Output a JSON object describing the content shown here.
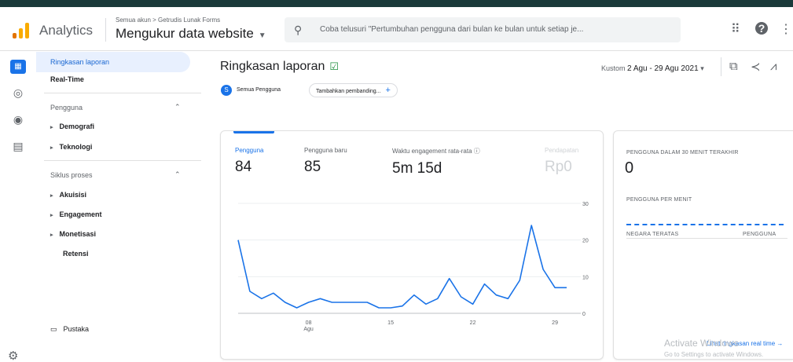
{
  "header": {
    "app_name": "Analytics",
    "breadcrumb": "Semua akun > Getrudis Lunak Forms",
    "property": "Mengukur data website",
    "search_placeholder": "Coba telusuri \"Pertumbuhan pengguna dari bulan ke bulan untuk setiap je...",
    "icons": [
      "apps-icon",
      "help-icon",
      "more-vert-icon"
    ]
  },
  "rail": {
    "icons": [
      "reports-icon",
      "explore-icon",
      "advertising-icon",
      "configure-icon"
    ]
  },
  "nav": {
    "summary": "Ringkasan laporan",
    "realtime": "Real-Time",
    "sec_user": "Pengguna",
    "user_items": [
      "Demografi",
      "Teknologi"
    ],
    "sec_lifecycle": "Siklus proses",
    "lifecycle_items": [
      "Akuisisi",
      "Engagement",
      "Monetisasi"
    ],
    "retention": "Retensi",
    "library": "Pustaka"
  },
  "main": {
    "title": "Ringkasan laporan",
    "date_prefix": "Kustom",
    "date_range": "2 Agu - 29 Agu 2021",
    "chip_letter": "S",
    "chip_all_users": "Semua Pengguna",
    "chip_compare": "Tambahkan pembanding...",
    "metrics": [
      {
        "label": "Pengguna",
        "value": "84"
      },
      {
        "label": "Pengguna baru",
        "value": "85"
      },
      {
        "label": "Waktu engagement rata-rata",
        "value": "5m 15d"
      },
      {
        "label": "Pendapatan",
        "value": "Rp0"
      }
    ]
  },
  "realtime": {
    "title": "PENGGUNA DALAM 30 MENIT TERAKHIR",
    "value": "0",
    "per_minute": "PENGGUNA PER MENIT",
    "col_country": "NEGARA TERATAS",
    "col_users": "PENGGUNA",
    "link": "Lihat ringkasan real time →"
  },
  "watermark": {
    "line1": "Activate Windows",
    "line2": "Go to Settings to activate Windows."
  },
  "colors": {
    "accent": "#1a73e8",
    "logo_orange": "#f9ab00",
    "logo_dark": "#e37400"
  },
  "chart_data": {
    "type": "line",
    "x_tick_labels": [
      "08\nAgu",
      "15",
      "22",
      "29"
    ],
    "x_tick_index": [
      6,
      13,
      20,
      27
    ],
    "y_ticks": [
      0,
      10,
      20,
      30
    ],
    "ylim": [
      0,
      30
    ],
    "series": [
      {
        "values": [
          20,
          6,
          4,
          5.5,
          3,
          1.5,
          3,
          4,
          3,
          3,
          3,
          3,
          1.5,
          1.5,
          2,
          5,
          2.5,
          4,
          9.5,
          4.5,
          2.5,
          8,
          5,
          4,
          9,
          24,
          12,
          7,
          7
        ]
      }
    ]
  }
}
